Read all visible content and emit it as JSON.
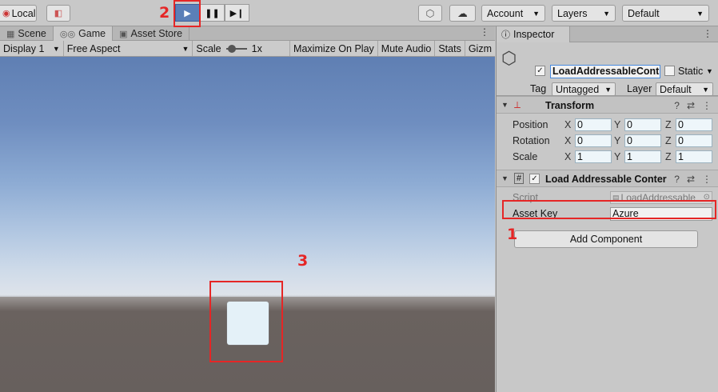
{
  "toolbar": {
    "local_label": "Local",
    "account_label": "Account",
    "layers_label": "Layers",
    "layout_label": "Default"
  },
  "left_tabs": [
    {
      "label": "Scene",
      "icon": "scene-grid-icon"
    },
    {
      "label": "Game",
      "icon": "gamepad-icon"
    },
    {
      "label": "Asset Store",
      "icon": "bag-icon"
    }
  ],
  "game_bar": {
    "display": "Display 1",
    "aspect": "Free Aspect",
    "scale_label": "Scale",
    "scale_value": "1x",
    "maximize": "Maximize On Play",
    "mute": "Mute Audio",
    "stats": "Stats",
    "gizmos": "Gizm"
  },
  "inspector": {
    "tab_label": "Inspector",
    "object_name": "LoadAddressableCont",
    "static_label": "Static",
    "tag_label": "Tag",
    "tag_value": "Untagged",
    "layer_label": "Layer",
    "layer_value": "Default",
    "transform": {
      "title": "Transform",
      "rows": [
        {
          "label": "Position",
          "x": "0",
          "y": "0",
          "z": "0"
        },
        {
          "label": "Rotation",
          "x": "0",
          "y": "0",
          "z": "0"
        },
        {
          "label": "Scale",
          "x": "1",
          "y": "1",
          "z": "1"
        }
      ],
      "axis_x": "X",
      "axis_y": "Y",
      "axis_z": "Z"
    },
    "script_component": {
      "title": "Load Addressable Conter",
      "script_label": "Script",
      "script_value": "LoadAddressable",
      "asset_key_label": "Asset Key",
      "asset_key_value": "Azure"
    },
    "add_component": "Add Component"
  },
  "annotations": {
    "one": "1",
    "two": "2",
    "three": "3"
  },
  "colors": {
    "annotation": "#e52626",
    "play_active": "#5b7fb8"
  }
}
